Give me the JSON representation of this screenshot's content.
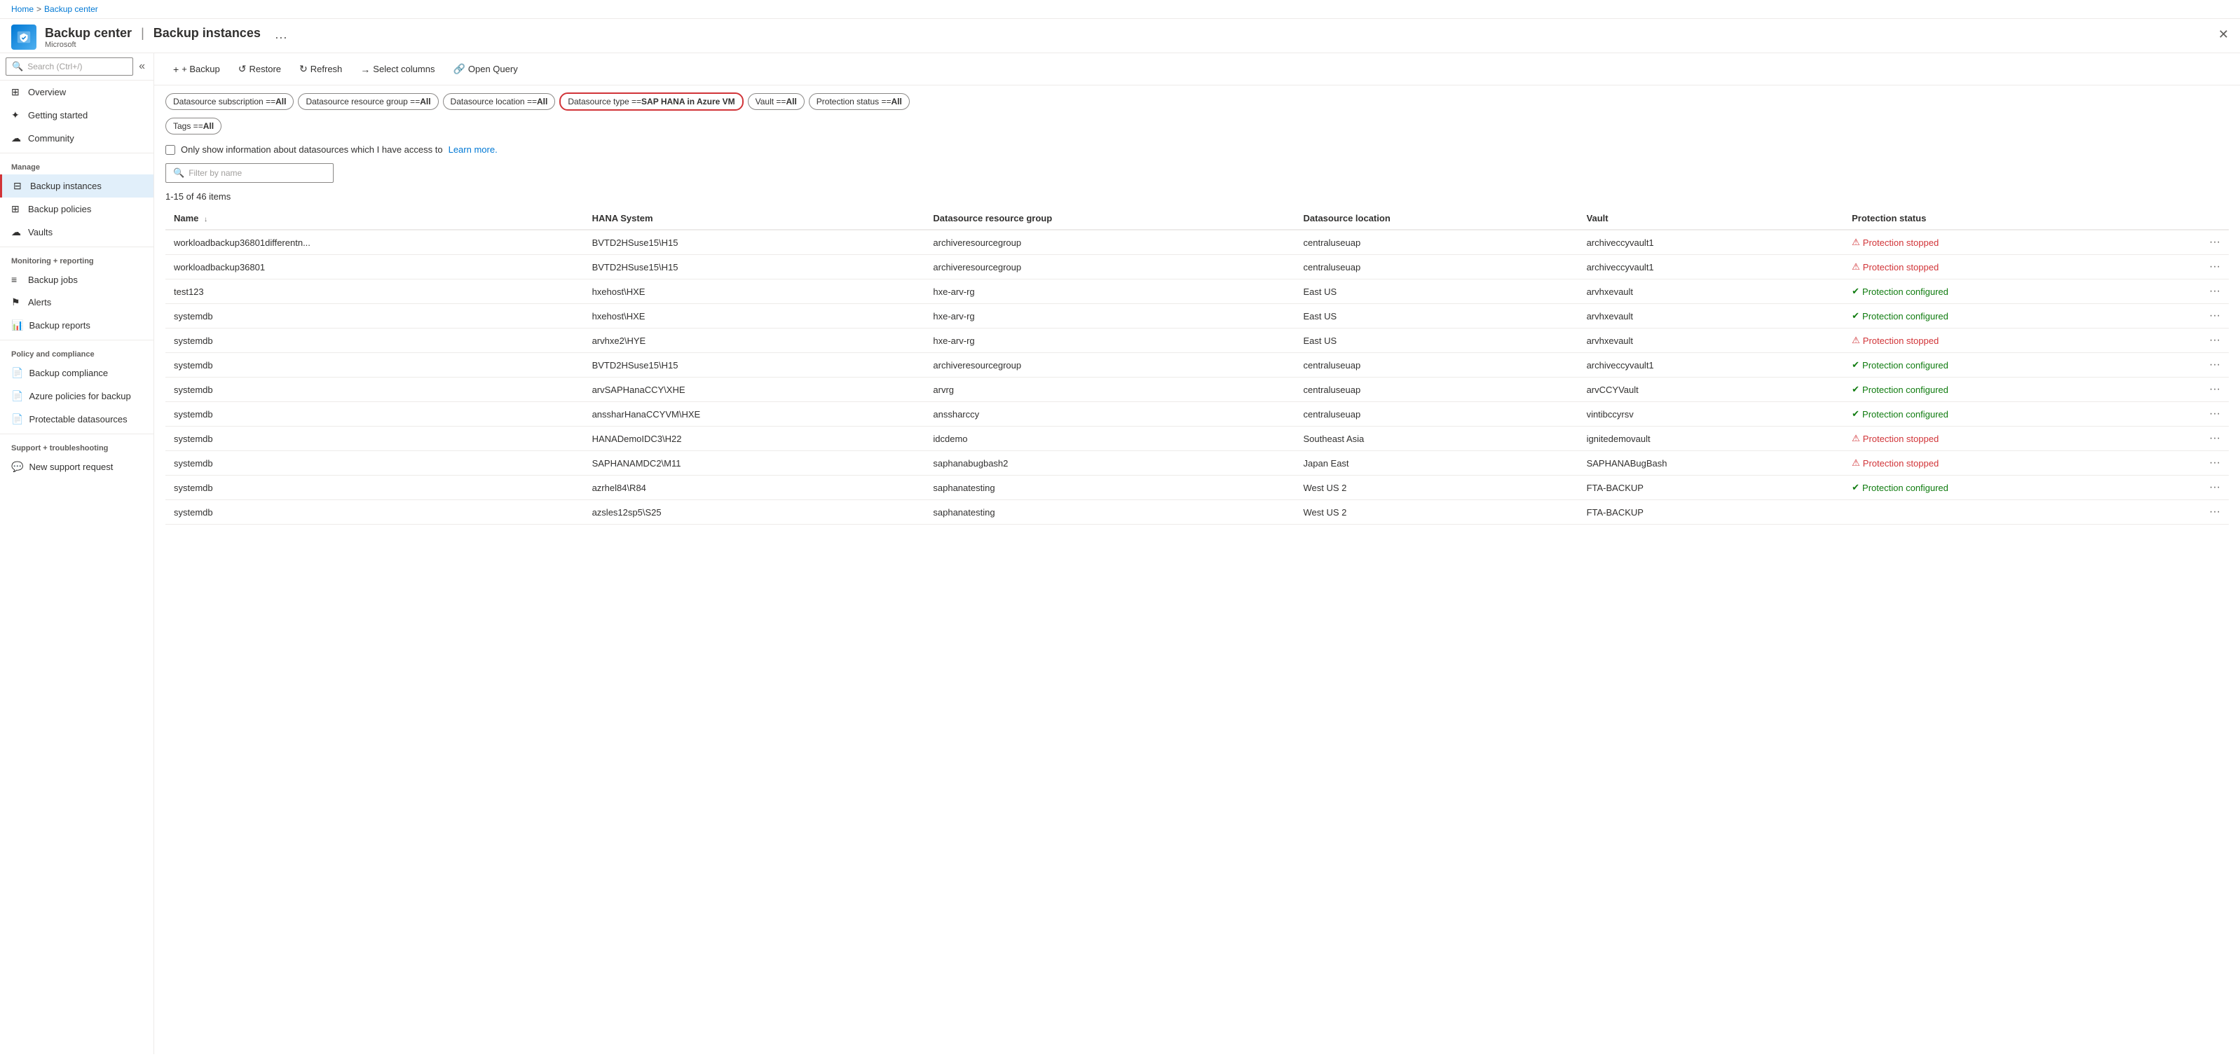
{
  "breadcrumb": {
    "home": "Home",
    "separator": ">",
    "current": "Backup center"
  },
  "header": {
    "title": "Backup center",
    "subtitle_separator": "|",
    "page_title": "Backup instances",
    "subtitle": "Microsoft",
    "ellipsis": "···"
  },
  "close_label": "✕",
  "sidebar": {
    "search_placeholder": "Search (Ctrl+/)",
    "collapse_icon": "«",
    "nav_items": [
      {
        "id": "overview",
        "label": "Overview",
        "icon": "⊞",
        "section": ""
      },
      {
        "id": "getting-started",
        "label": "Getting started",
        "icon": "✦",
        "section": ""
      },
      {
        "id": "community",
        "label": "Community",
        "icon": "☁",
        "section": ""
      }
    ],
    "manage_section": "Manage",
    "manage_items": [
      {
        "id": "backup-instances",
        "label": "Backup instances",
        "icon": "⊟",
        "active": true
      },
      {
        "id": "backup-policies",
        "label": "Backup policies",
        "icon": "⊞",
        "active": false
      },
      {
        "id": "vaults",
        "label": "Vaults",
        "icon": "☁",
        "active": false
      }
    ],
    "monitoring_section": "Monitoring + reporting",
    "monitoring_items": [
      {
        "id": "backup-jobs",
        "label": "Backup jobs",
        "icon": "≡",
        "active": false
      },
      {
        "id": "alerts",
        "label": "Alerts",
        "icon": "⚑",
        "active": false
      },
      {
        "id": "backup-reports",
        "label": "Backup reports",
        "icon": "📊",
        "active": false
      }
    ],
    "policy_section": "Policy and compliance",
    "policy_items": [
      {
        "id": "backup-compliance",
        "label": "Backup compliance",
        "icon": "📄",
        "active": false
      },
      {
        "id": "azure-policies",
        "label": "Azure policies for backup",
        "icon": "📄",
        "active": false
      },
      {
        "id": "protectable-datasources",
        "label": "Protectable datasources",
        "icon": "📄",
        "active": false
      }
    ],
    "support_section": "Support + troubleshooting",
    "support_items": [
      {
        "id": "new-support-request",
        "label": "New support request",
        "icon": "💬",
        "active": false
      }
    ]
  },
  "toolbar": {
    "backup_label": "+ Backup",
    "restore_label": "Restore",
    "refresh_label": "Refresh",
    "select_columns_label": "Select columns",
    "open_query_label": "Open Query"
  },
  "filters": [
    {
      "id": "subscription",
      "text": "Datasource subscription == ",
      "bold": "All",
      "active": false
    },
    {
      "id": "resource-group",
      "text": "Datasource resource group == ",
      "bold": "All",
      "active": false
    },
    {
      "id": "location",
      "text": "Datasource location == ",
      "bold": "All",
      "active": false
    },
    {
      "id": "type",
      "text": "Datasource type == ",
      "bold": "SAP HANA in Azure VM",
      "active": true
    },
    {
      "id": "vault",
      "text": "Vault == ",
      "bold": "All",
      "active": false
    },
    {
      "id": "protection-status",
      "text": "Protection status == ",
      "bold": "All",
      "active": false
    },
    {
      "id": "tags",
      "text": "Tags == ",
      "bold": "All",
      "active": false
    }
  ],
  "datasource_checkbox": {
    "label": "Only show information about datasources which I have access to",
    "link_text": "Learn more."
  },
  "filter_placeholder": "Filter by name",
  "item_count": "1-15 of 46 items",
  "table": {
    "columns": [
      {
        "id": "name",
        "label": "Name",
        "sortable": true
      },
      {
        "id": "hana-system",
        "label": "HANA System",
        "sortable": false
      },
      {
        "id": "resource-group",
        "label": "Datasource resource group",
        "sortable": false
      },
      {
        "id": "location",
        "label": "Datasource location",
        "sortable": false
      },
      {
        "id": "vault",
        "label": "Vault",
        "sortable": false
      },
      {
        "id": "protection-status",
        "label": "Protection status",
        "sortable": false
      },
      {
        "id": "actions",
        "label": "",
        "sortable": false
      }
    ],
    "rows": [
      {
        "name": "workloadbackup36801differentn...",
        "hana_system": "BVTD2HSuse15\\H15",
        "resource_group": "archiveresourcegroup",
        "location": "centraluseuap",
        "vault": "archiveccyvault1",
        "protection_status": "Protection stopped",
        "status_type": "stopped"
      },
      {
        "name": "workloadbackup36801",
        "hana_system": "BVTD2HSuse15\\H15",
        "resource_group": "archiveresourcegroup",
        "location": "centraluseuap",
        "vault": "archiveccyvault1",
        "protection_status": "Protection stopped",
        "status_type": "stopped"
      },
      {
        "name": "test123",
        "hana_system": "hxehost\\HXE",
        "resource_group": "hxe-arv-rg",
        "location": "East US",
        "vault": "arvhxevault",
        "protection_status": "Protection configured",
        "status_type": "configured"
      },
      {
        "name": "systemdb",
        "hana_system": "hxehost\\HXE",
        "resource_group": "hxe-arv-rg",
        "location": "East US",
        "vault": "arvhxevault",
        "protection_status": "Protection configured",
        "status_type": "configured"
      },
      {
        "name": "systemdb",
        "hana_system": "arvhxe2\\HYE",
        "resource_group": "hxe-arv-rg",
        "location": "East US",
        "vault": "arvhxevault",
        "protection_status": "Protection stopped",
        "status_type": "stopped"
      },
      {
        "name": "systemdb",
        "hana_system": "BVTD2HSuse15\\H15",
        "resource_group": "archiveresourcegroup",
        "location": "centraluseuap",
        "vault": "archiveccyvault1",
        "protection_status": "Protection configured",
        "status_type": "configured"
      },
      {
        "name": "systemdb",
        "hana_system": "arvSAPHanaCCY\\XHE",
        "resource_group": "arvrg",
        "location": "centraluseuap",
        "vault": "arvCCYVault",
        "protection_status": "Protection configured",
        "status_type": "configured"
      },
      {
        "name": "systemdb",
        "hana_system": "anssharHanaCCYVM\\HXE",
        "resource_group": "anssharccy",
        "location": "centraluseuap",
        "vault": "vintibccyrsv",
        "protection_status": "Protection configured",
        "status_type": "configured"
      },
      {
        "name": "systemdb",
        "hana_system": "HANADemoIDC3\\H22",
        "resource_group": "idcdemo",
        "location": "Southeast Asia",
        "vault": "ignitedemovault",
        "protection_status": "Protection stopped",
        "status_type": "stopped"
      },
      {
        "name": "systemdb",
        "hana_system": "SAPHANAMDC2\\M11",
        "resource_group": "saphanabugbash2",
        "location": "Japan East",
        "vault": "SAPHANABugBash",
        "protection_status": "Protection stopped",
        "status_type": "stopped"
      },
      {
        "name": "systemdb",
        "hana_system": "azrhel84\\R84",
        "resource_group": "saphanatesting",
        "location": "West US 2",
        "vault": "FTA-BACKUP",
        "protection_status": "Protection configured",
        "status_type": "configured"
      },
      {
        "name": "systemdb",
        "hana_system": "azsles12sp5\\S25",
        "resource_group": "saphanatesting",
        "location": "West US 2",
        "vault": "FTA-BACKUP",
        "protection_status": "",
        "status_type": ""
      }
    ]
  }
}
